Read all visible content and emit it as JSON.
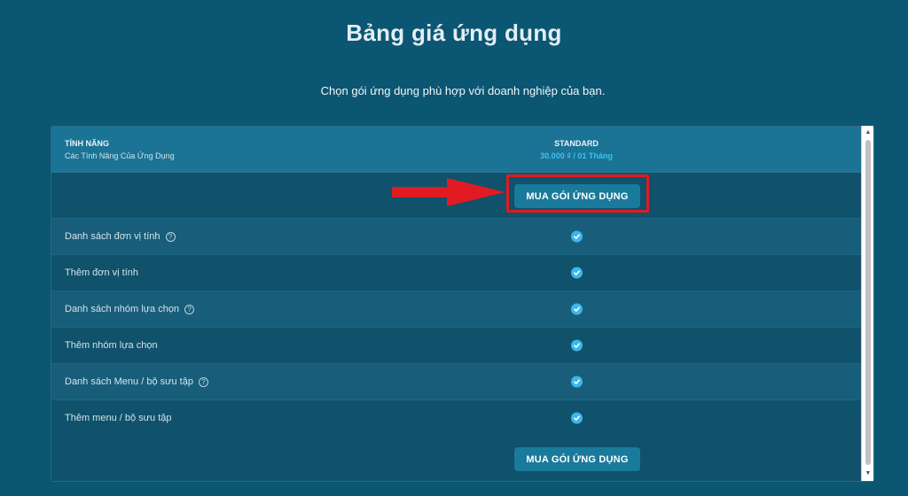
{
  "page": {
    "title": "Bảng giá ứng dụng",
    "subtitle": "Chọn gói ứng dụng phù hợp với doanh nghiệp của bạn."
  },
  "table": {
    "features_header": "TÍNH NĂNG",
    "features_subheader": "Các Tính Năng Của Ứng Dụng",
    "plan": {
      "name": "STANDARD",
      "price": "30.000 ₫ / 01 Tháng"
    },
    "buy_label": "MUA GÓI ỨNG DỤNG",
    "rows": [
      {
        "label": "Danh sách đơn vị tính",
        "help": true,
        "included": true
      },
      {
        "label": "Thêm đơn vị tính",
        "help": false,
        "included": true
      },
      {
        "label": "Danh sách nhóm lựa chọn",
        "help": true,
        "included": true
      },
      {
        "label": "Thêm nhóm lựa chọn",
        "help": false,
        "included": true
      },
      {
        "label": "Danh sách Menu / bộ sưu tập",
        "help": true,
        "included": true
      },
      {
        "label": "Thêm menu / bộ sưu tập",
        "help": false,
        "included": true
      }
    ]
  },
  "icons": {
    "help": "question-circle-icon",
    "check": "check-circle-icon",
    "arrow": "red-arrow-right-icon"
  },
  "colors": {
    "background": "#0b5672",
    "header": "#1b7396",
    "price": "#3ec0f0",
    "check": "#3ab7ec",
    "button": "#1a7a9b",
    "highlight": "#e21a22"
  }
}
